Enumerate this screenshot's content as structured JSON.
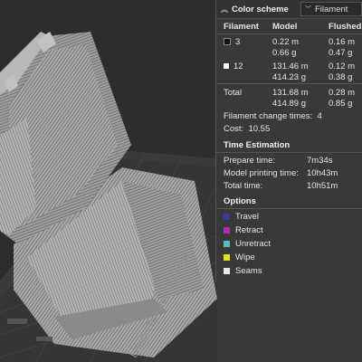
{
  "panel": {
    "header": {
      "title": "Color scheme",
      "select_value": "Filament"
    },
    "columns": {
      "filament": "Filament",
      "model": "Model",
      "flushed": "Flushed"
    },
    "filaments": [
      {
        "id": "3",
        "color": "#111111",
        "model_m": "0.22 m",
        "model_g": "0.66 g",
        "flushed_m": "0.16 m",
        "flushed_g": "0.47 g"
      },
      {
        "id": "12",
        "color": "#ffffff",
        "model_m": "131.46 m",
        "model_g": "414.23 g",
        "flushed_m": "0.12 m",
        "flushed_g": "0.38 g"
      }
    ],
    "total": {
      "label": "Total",
      "model_m": "131.68 m",
      "model_g": "414.89 g",
      "flushed_m": "0.28 m",
      "flushed_g": "0.85 g"
    },
    "filament_change": {
      "label": "Filament change times:",
      "value": "4"
    },
    "cost": {
      "label": "Cost:",
      "value": "10.55"
    },
    "time_estimation": {
      "title": "Time Estimation",
      "prepare": {
        "label": "Prepare time:",
        "value": "7m34s"
      },
      "model_printing": {
        "label": "Model printing time:",
        "value": "10h43m"
      },
      "total": {
        "label": "Total time:",
        "value": "10h51m"
      }
    },
    "options": {
      "title": "Options",
      "items": [
        {
          "label": "Travel",
          "color": "#3a3aa8"
        },
        {
          "label": "Retract",
          "color": "#b52ab5"
        },
        {
          "label": "Unretract",
          "color": "#5ab8c9"
        },
        {
          "label": "Wipe",
          "color": "#e8e21b"
        },
        {
          "label": "Seams",
          "color": "#e8e8e8"
        }
      ]
    }
  },
  "plate": {
    "label": "Bambu Textured PEI Plate"
  }
}
